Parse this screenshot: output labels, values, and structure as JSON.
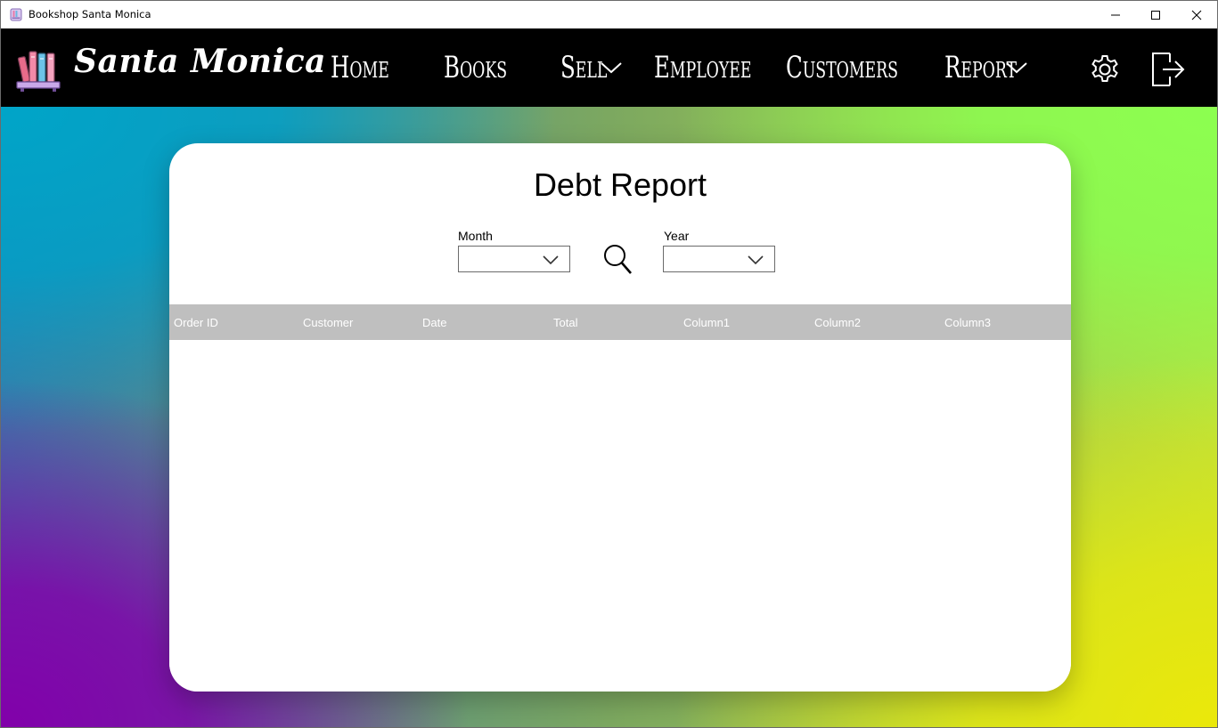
{
  "window": {
    "title": "Bookshop Santa Monica"
  },
  "navbar": {
    "brand": "Santa Monica",
    "items": [
      {
        "label": "Home",
        "has_dropdown": false
      },
      {
        "label": "Books",
        "has_dropdown": false
      },
      {
        "label": "Sell",
        "has_dropdown": true
      },
      {
        "label": "Employee",
        "has_dropdown": false
      },
      {
        "label": "Customers",
        "has_dropdown": false
      },
      {
        "label": "Report",
        "has_dropdown": true
      }
    ],
    "icons": [
      "gear-icon",
      "logout-icon"
    ]
  },
  "report": {
    "title": "Debt Report",
    "month_label": "Month",
    "month_value": "",
    "year_label": "Year",
    "year_value": "",
    "search_icon": "search-icon",
    "columns": [
      "Order ID",
      "Customer",
      "Date",
      "Total",
      "Column1",
      "Column2",
      "Column3"
    ],
    "rows": []
  },
  "colors": {
    "navbar_bg": "#000000",
    "header_bg": "#bfbfbf",
    "header_text": "#ffffff",
    "card_bg": "#ffffff"
  }
}
